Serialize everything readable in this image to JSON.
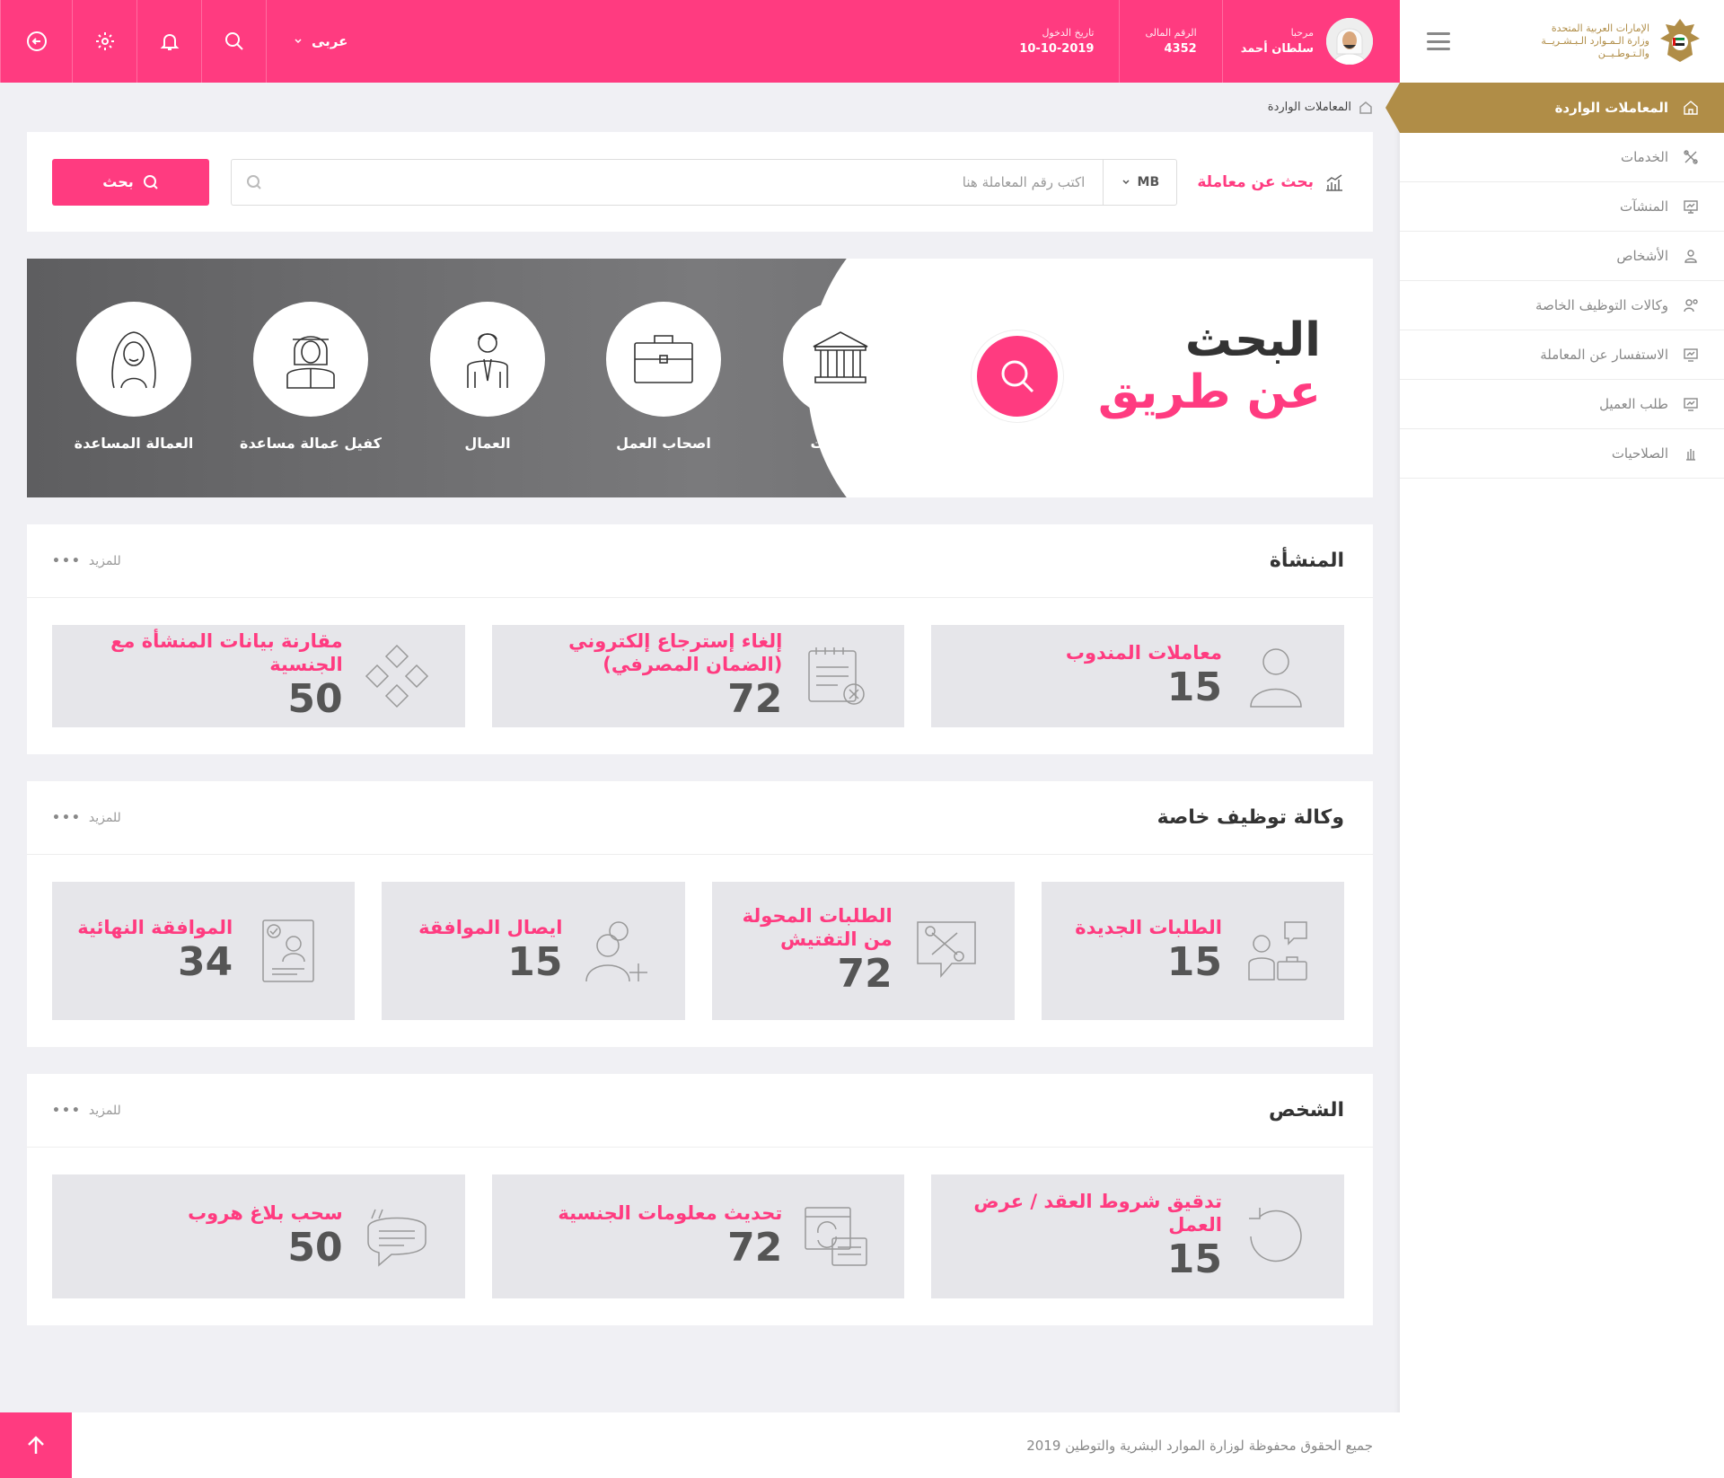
{
  "sidebar": {
    "brand_line1": "الإمارات العربية المتحدة",
    "brand_line2": "وزارة الـمـوارد الـبـشـريــة",
    "brand_line3": "والـتـوطـيــن",
    "active_item": {
      "label": "المعاملات الواردة",
      "icon": "home-icon"
    },
    "items": [
      {
        "label": "الخدمات",
        "icon": "tools-icon"
      },
      {
        "label": "المنشآت",
        "icon": "monitor-icon"
      },
      {
        "label": "الأشخاص",
        "icon": "person-icon"
      },
      {
        "label": "وكالات التوظيف الخاصة",
        "icon": "user-gear-icon"
      },
      {
        "label": "الاستفسار عن المعاملة",
        "icon": "monitor-chart-icon"
      },
      {
        "label": "طلب العميل",
        "icon": "monitor-chart-icon"
      },
      {
        "label": "الصلاحيات",
        "icon": "hand-icon"
      }
    ]
  },
  "topbar": {
    "greeting": "مرحبا",
    "user_name": "سلطان أحمد",
    "id_label": "الرقم المالى",
    "id_value": "4352",
    "login_label": "تاريخ الدخول",
    "login_value": "10-10-2019",
    "language": "عربى"
  },
  "breadcrumb": {
    "current": "المعاملات الواردة"
  },
  "search": {
    "label": "بحث عن معاملة",
    "select_value": "MB",
    "placeholder": "اكتب رقم المعاملة هنا",
    "button_label": "بحث"
  },
  "banner": {
    "title_line1": "البحث",
    "title_line2": "عن طريق",
    "categories": [
      {
        "label": "المنشآت",
        "icon": "building-icon"
      },
      {
        "label": "اصحاب العمل",
        "icon": "briefcase-icon"
      },
      {
        "label": "العمال",
        "icon": "worker-icon"
      },
      {
        "label": "كفيل عمالة مساعدة",
        "icon": "sponsor-icon"
      },
      {
        "label": "العمالة المساعدة",
        "icon": "domestic-worker-icon"
      }
    ]
  },
  "sections": [
    {
      "title": "المنشأة",
      "more": "للمزيد",
      "tiles": [
        {
          "label": "معاملات المندوب",
          "value": "15",
          "icon": "user-outline-icon"
        },
        {
          "label": "إلغاء إسترجاع إلكتروني (الضمان المصرفي)",
          "value": "72",
          "icon": "calendar-cancel-icon"
        },
        {
          "label": "مقارنة بيانات المنشأة مع الجنسية",
          "value": "50",
          "icon": "diamonds-icon"
        }
      ]
    },
    {
      "title": "وكالة توظيف خاصة",
      "more": "للمزيد",
      "tiles": [
        {
          "label": "الطلبات الجديدة",
          "value": "15",
          "icon": "meeting-icon"
        },
        {
          "label": "الطلبات المحولة من التفتيش",
          "value": "72",
          "icon": "tools-chat-icon"
        },
        {
          "label": "ايصال الموافقة",
          "value": "15",
          "icon": "add-user-icon"
        },
        {
          "label": "الموافقة النهائية",
          "value": "34",
          "icon": "profile-check-icon"
        }
      ]
    },
    {
      "title": "الشخص",
      "more": "للمزيد",
      "tiles": [
        {
          "label": "تدقيق شروط العقد / عرض العمل",
          "value": "15",
          "icon": "history-icon"
        },
        {
          "label": "تحديث معلومات الجنسية",
          "value": "72",
          "icon": "sync-window-icon"
        },
        {
          "label": "سحب بلاغ هروب",
          "value": "50",
          "icon": "quote-chat-icon"
        }
      ]
    }
  ],
  "footer": {
    "text": "جميع الحقوق محفوظة لوزارة الموارد البشرية والتوطين 2019"
  },
  "colors": {
    "accent": "#ff3b80",
    "gold": "#b08d47",
    "banner_gray": "#6e6e70"
  }
}
